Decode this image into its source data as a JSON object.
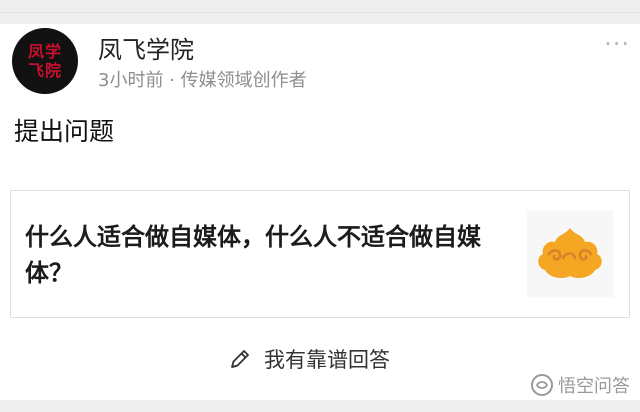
{
  "author": {
    "avatar_text": "凤学飞院",
    "name": "凤飞学院",
    "meta": "3小时前 · 传媒领域创作者"
  },
  "post": {
    "action": "提出问题",
    "question_title": "什么人适合做自媒体，什么人不适合做自媒体？"
  },
  "actions": {
    "answer_label": "我有靠谱回答",
    "more_label": "···"
  },
  "watermark": {
    "text": "悟空问答"
  },
  "colors": {
    "avatar_bg": "#111111",
    "avatar_text": "#c8102e",
    "thumb_orange": "#f5a623"
  }
}
